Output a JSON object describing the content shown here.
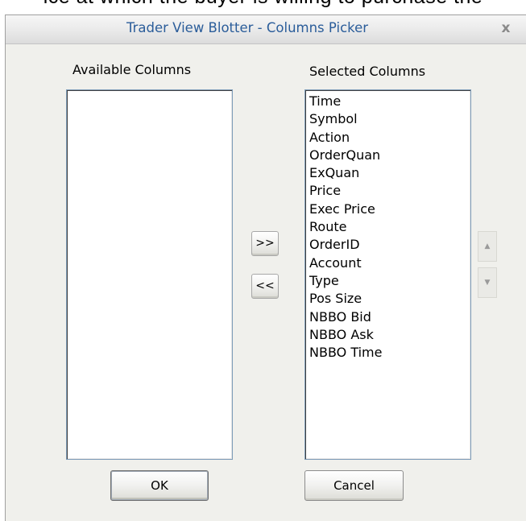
{
  "background_text": "ice at which the buyer is willing to purchase the",
  "window": {
    "title": "Trader View Blotter - Columns Picker",
    "close_glyph": "x"
  },
  "available": {
    "label": "Available Columns",
    "items": []
  },
  "selected": {
    "label": "Selected Columns",
    "items": [
      "Time",
      "Symbol",
      "Action",
      "OrderQuan",
      "ExQuan",
      "Price",
      "Exec Price",
      "Route",
      "OrderID",
      "Account",
      "Type",
      "Pos Size",
      "NBBO Bid",
      "NBBO Ask",
      "NBBO Time"
    ]
  },
  "buttons": {
    "add": ">>",
    "remove": "<<",
    "ok": "OK",
    "cancel": "Cancel",
    "move_up": "▲",
    "move_down": "▼"
  },
  "icons": {
    "close": "close-icon",
    "move_up": "arrow-up-icon",
    "move_down": "arrow-down-icon"
  }
}
